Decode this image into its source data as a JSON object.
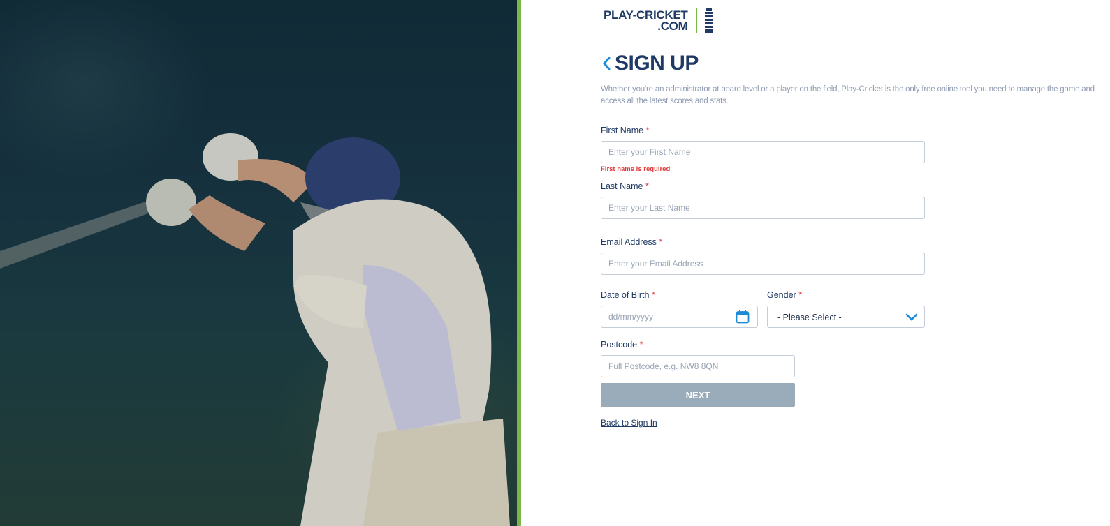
{
  "logo": {
    "line1": "PLAY-CRICKET",
    "line2": ".COM"
  },
  "page": {
    "title": "SIGN UP",
    "intro": "Whether you're an administrator at board level or a player on the field, Play-Cricket is the only free online tool you need to manage the game and access all the latest scores and stats."
  },
  "form": {
    "first_name": {
      "label": "First Name",
      "placeholder": "Enter your First Name",
      "value": "",
      "error": "First name is required"
    },
    "last_name": {
      "label": "Last Name",
      "placeholder": "Enter your Last Name",
      "value": ""
    },
    "email": {
      "label": "Email Address",
      "placeholder": "Enter your Email Address",
      "value": ""
    },
    "dob": {
      "label": "Date of Birth",
      "placeholder": "dd/mm/yyyy",
      "value": ""
    },
    "gender": {
      "label": "Gender",
      "selected": "- Please Select -"
    },
    "postcode": {
      "label": "Postcode",
      "placeholder": "Full Postcode, e.g. NW8 8QN",
      "value": ""
    },
    "required_marker": "*",
    "next_label": "NEXT",
    "back_link": "Back to Sign In"
  },
  "colors": {
    "brand_navy": "#1f3a64",
    "accent_green": "#7ab648",
    "accent_blue": "#1c8ad6",
    "error_red": "#e03b3b",
    "button_disabled": "#9aabba"
  },
  "icons": {
    "back": "chevron-left-icon",
    "calendar": "calendar-icon",
    "dropdown": "chevron-down-icon",
    "ecb_logo": "ecb-crest-icon"
  }
}
